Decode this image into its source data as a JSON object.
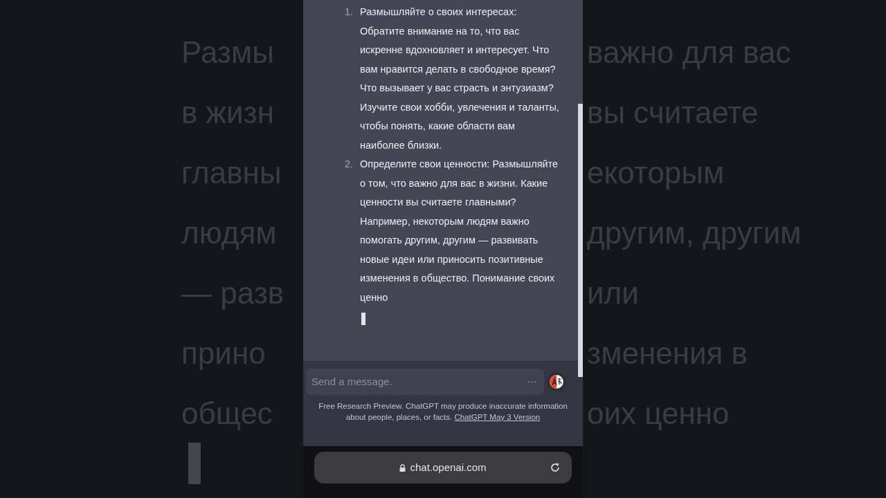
{
  "backdrop": {
    "left_lines": [
      "Размы",
      "в жизн",
      "главны",
      "людям",
      "— разв",
      "прино",
      "общес"
    ],
    "right_lines": [
      "важно для вас",
      "вы считаете",
      "екоторым",
      "другим, другим",
      "или",
      "зменения в",
      "оих ценно"
    ],
    "cursor_visible": true
  },
  "chat": {
    "items": [
      {
        "number": "1.",
        "text": "Размышляйте о своих интересах: Обратите внимание на то, что вас искренне вдохновляет и интересует. Что вам нравится делать в свободное время? Что вызывает у вас страсть и энтузиазм? Изучите свои хобби, увлечения и таланты, чтобы понять, какие области вам наиболее близки."
      },
      {
        "number": "2.",
        "text": "Определите свои ценности: Размышляйте о том, что важно для вас в жизни. Какие ценности вы считаете главными? Например, некоторым людям важно помогать другим, другим — развивать новые идеи или приносить позитивные изменения в общество. Понимание своих ценно"
      }
    ],
    "cursor_visible": true
  },
  "composer": {
    "placeholder": "Send a message.",
    "more": "···"
  },
  "disclaimer": {
    "text": "Free Research Preview. ChatGPT may produce inaccurate information about people, places, or facts.",
    "link": "ChatGPT May 3 Version"
  },
  "address_bar": {
    "url": "chat.openai.com"
  }
}
